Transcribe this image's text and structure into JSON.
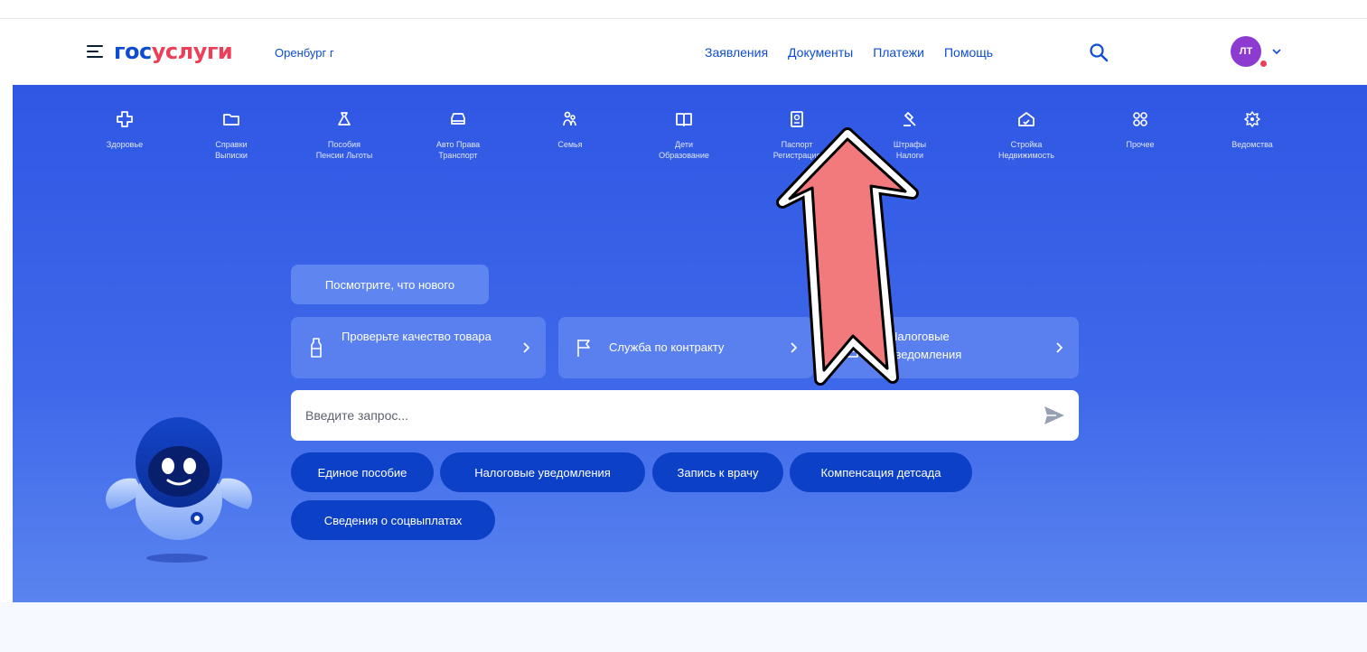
{
  "header": {
    "logo_part1": "гос",
    "logo_part2": "услуги",
    "region": "Оренбург г",
    "nav": [
      "Заявления",
      "Документы",
      "Платежи",
      "Помощь"
    ],
    "avatar_initials": "ЛТ"
  },
  "categories": [
    {
      "label": "Здоровье",
      "icon": "cross-icon"
    },
    {
      "label": "Справки\nВыписки",
      "icon": "folder-icon"
    },
    {
      "label": "Пособия\nПенсии Льготы",
      "icon": "bag-icon"
    },
    {
      "label": "Авто Права\nТранспорт",
      "icon": "car-icon"
    },
    {
      "label": "Семья",
      "icon": "family-icon"
    },
    {
      "label": "Дети\nОбразование",
      "icon": "book-icon"
    },
    {
      "label": "Паспорт\nРегистрация",
      "icon": "passport-icon"
    },
    {
      "label": "Штрафы\nНалоги",
      "icon": "gavel-icon"
    },
    {
      "label": "Стройка\nНедвижимость",
      "icon": "house-icon"
    },
    {
      "label": "Прочее",
      "icon": "grid-icon"
    },
    {
      "label": "Ведомства",
      "icon": "emblem-icon"
    }
  ],
  "main": {
    "whats_new": "Посмотрите, что нового",
    "quick_links": [
      {
        "label": "Проверьте качество товара",
        "icon": "bottle-icon"
      },
      {
        "label": "Служба по контракту",
        "icon": "flag-icon"
      },
      {
        "label": "Налоговые уведомления",
        "icon": "document-icon"
      }
    ],
    "search_placeholder": "Введите запрос...",
    "chips": [
      "Единое пособие",
      "Налоговые уведомления",
      "Запись к врачу",
      "Компенсация детсада",
      "Сведения о соцвыплатах"
    ]
  },
  "colors": {
    "brand_blue": "#0d4cd3",
    "brand_red": "#ee3f58",
    "hero_blue": "#3a62e8",
    "chip_blue": "#0c40c6",
    "annotation_arrow": "#f37a7c"
  }
}
